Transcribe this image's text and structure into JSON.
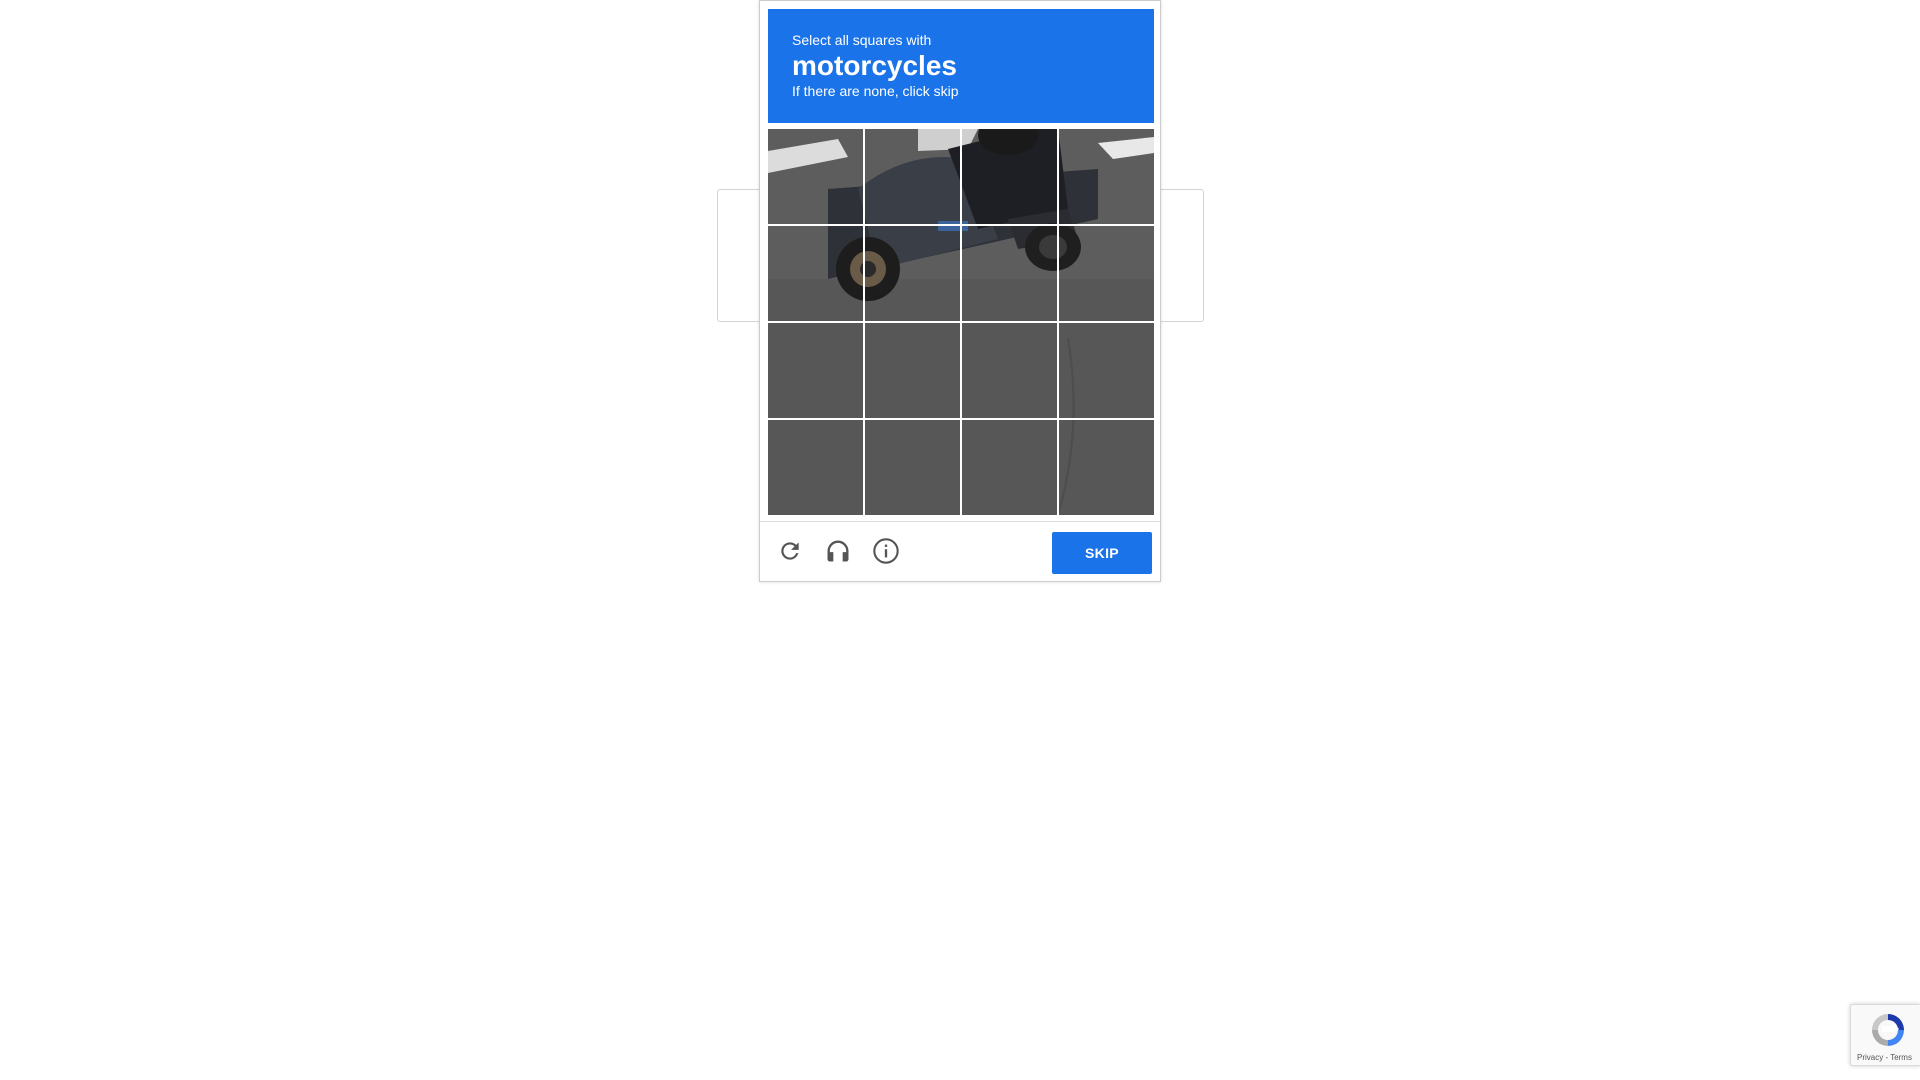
{
  "challenge": {
    "instruction": "Select all squares with",
    "keyword": "motorcycles",
    "hint": "If there are none, click skip",
    "skip_label": "SKIP",
    "colors": {
      "header": "#1a73e8",
      "button": "#1a73e8"
    },
    "grid": {
      "rows": 4,
      "cols": 4
    },
    "tools": [
      {
        "name": "reload",
        "icon": "reload-icon"
      },
      {
        "name": "audio",
        "icon": "headphones-icon"
      },
      {
        "name": "info",
        "icon": "info-icon"
      }
    ]
  },
  "badge": {
    "text": "Privacy - Terms",
    "icon": "recaptcha-logo-icon"
  }
}
